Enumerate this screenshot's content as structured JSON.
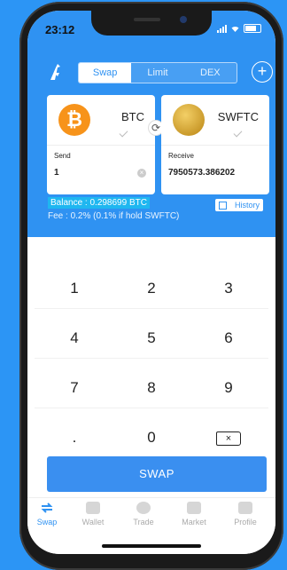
{
  "status": {
    "time": "23:12"
  },
  "header": {
    "tabs": [
      {
        "label": "Swap",
        "active": true
      },
      {
        "label": "Limit",
        "active": false
      },
      {
        "label": "DEX",
        "active": false
      }
    ],
    "add_icon": "plus-circle-icon"
  },
  "send": {
    "symbol": "BTC",
    "label": "Send",
    "amount": "1"
  },
  "receive": {
    "symbol": "SWFTC",
    "label": "Receive",
    "amount": "7950573.386202"
  },
  "info": {
    "balance": "Balance : 0.298699 BTC",
    "fee": "Fee : 0.2%  (0.1% if hold SWFTC)",
    "history": "History"
  },
  "keypad": {
    "keys": [
      "1",
      "2",
      "3",
      "4",
      "5",
      "6",
      "7",
      "8",
      "9",
      ".",
      "0"
    ]
  },
  "swap_button": "SWAP",
  "tabbar": [
    {
      "label": "Swap",
      "active": true
    },
    {
      "label": "Wallet",
      "active": false
    },
    {
      "label": "Trade",
      "active": false
    },
    {
      "label": "Market",
      "active": false
    },
    {
      "label": "Profile",
      "active": false
    }
  ],
  "colors": {
    "accent": "#2f92f2",
    "background": "#2c95f5",
    "btc": "#f7931a"
  }
}
